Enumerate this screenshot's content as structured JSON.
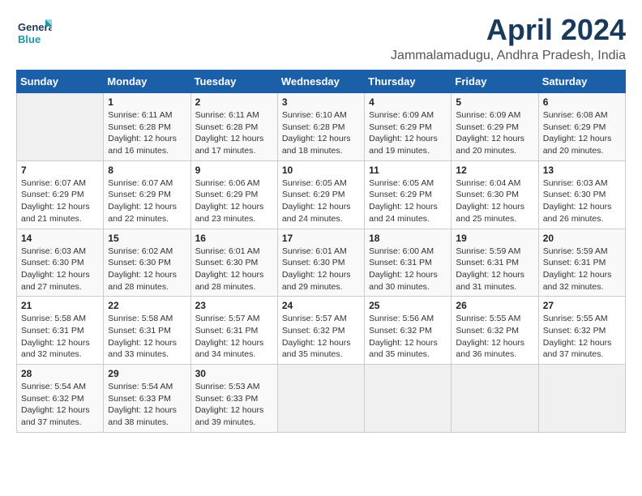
{
  "logo": {
    "line1": "General",
    "line2": "Blue"
  },
  "title": "April 2024",
  "subtitle": "Jammalamadugu, Andhra Pradesh, India",
  "weekdays": [
    "Sunday",
    "Monday",
    "Tuesday",
    "Wednesday",
    "Thursday",
    "Friday",
    "Saturday"
  ],
  "weeks": [
    [
      {
        "day": "",
        "info": ""
      },
      {
        "day": "1",
        "info": "Sunrise: 6:11 AM\nSunset: 6:28 PM\nDaylight: 12 hours\nand 16 minutes."
      },
      {
        "day": "2",
        "info": "Sunrise: 6:11 AM\nSunset: 6:28 PM\nDaylight: 12 hours\nand 17 minutes."
      },
      {
        "day": "3",
        "info": "Sunrise: 6:10 AM\nSunset: 6:28 PM\nDaylight: 12 hours\nand 18 minutes."
      },
      {
        "day": "4",
        "info": "Sunrise: 6:09 AM\nSunset: 6:29 PM\nDaylight: 12 hours\nand 19 minutes."
      },
      {
        "day": "5",
        "info": "Sunrise: 6:09 AM\nSunset: 6:29 PM\nDaylight: 12 hours\nand 20 minutes."
      },
      {
        "day": "6",
        "info": "Sunrise: 6:08 AM\nSunset: 6:29 PM\nDaylight: 12 hours\nand 20 minutes."
      }
    ],
    [
      {
        "day": "7",
        "info": "Sunrise: 6:07 AM\nSunset: 6:29 PM\nDaylight: 12 hours\nand 21 minutes."
      },
      {
        "day": "8",
        "info": "Sunrise: 6:07 AM\nSunset: 6:29 PM\nDaylight: 12 hours\nand 22 minutes."
      },
      {
        "day": "9",
        "info": "Sunrise: 6:06 AM\nSunset: 6:29 PM\nDaylight: 12 hours\nand 23 minutes."
      },
      {
        "day": "10",
        "info": "Sunrise: 6:05 AM\nSunset: 6:29 PM\nDaylight: 12 hours\nand 24 minutes."
      },
      {
        "day": "11",
        "info": "Sunrise: 6:05 AM\nSunset: 6:29 PM\nDaylight: 12 hours\nand 24 minutes."
      },
      {
        "day": "12",
        "info": "Sunrise: 6:04 AM\nSunset: 6:30 PM\nDaylight: 12 hours\nand 25 minutes."
      },
      {
        "day": "13",
        "info": "Sunrise: 6:03 AM\nSunset: 6:30 PM\nDaylight: 12 hours\nand 26 minutes."
      }
    ],
    [
      {
        "day": "14",
        "info": "Sunrise: 6:03 AM\nSunset: 6:30 PM\nDaylight: 12 hours\nand 27 minutes."
      },
      {
        "day": "15",
        "info": "Sunrise: 6:02 AM\nSunset: 6:30 PM\nDaylight: 12 hours\nand 28 minutes."
      },
      {
        "day": "16",
        "info": "Sunrise: 6:01 AM\nSunset: 6:30 PM\nDaylight: 12 hours\nand 28 minutes."
      },
      {
        "day": "17",
        "info": "Sunrise: 6:01 AM\nSunset: 6:30 PM\nDaylight: 12 hours\nand 29 minutes."
      },
      {
        "day": "18",
        "info": "Sunrise: 6:00 AM\nSunset: 6:31 PM\nDaylight: 12 hours\nand 30 minutes."
      },
      {
        "day": "19",
        "info": "Sunrise: 5:59 AM\nSunset: 6:31 PM\nDaylight: 12 hours\nand 31 minutes."
      },
      {
        "day": "20",
        "info": "Sunrise: 5:59 AM\nSunset: 6:31 PM\nDaylight: 12 hours\nand 32 minutes."
      }
    ],
    [
      {
        "day": "21",
        "info": "Sunrise: 5:58 AM\nSunset: 6:31 PM\nDaylight: 12 hours\nand 32 minutes."
      },
      {
        "day": "22",
        "info": "Sunrise: 5:58 AM\nSunset: 6:31 PM\nDaylight: 12 hours\nand 33 minutes."
      },
      {
        "day": "23",
        "info": "Sunrise: 5:57 AM\nSunset: 6:31 PM\nDaylight: 12 hours\nand 34 minutes."
      },
      {
        "day": "24",
        "info": "Sunrise: 5:57 AM\nSunset: 6:32 PM\nDaylight: 12 hours\nand 35 minutes."
      },
      {
        "day": "25",
        "info": "Sunrise: 5:56 AM\nSunset: 6:32 PM\nDaylight: 12 hours\nand 35 minutes."
      },
      {
        "day": "26",
        "info": "Sunrise: 5:55 AM\nSunset: 6:32 PM\nDaylight: 12 hours\nand 36 minutes."
      },
      {
        "day": "27",
        "info": "Sunrise: 5:55 AM\nSunset: 6:32 PM\nDaylight: 12 hours\nand 37 minutes."
      }
    ],
    [
      {
        "day": "28",
        "info": "Sunrise: 5:54 AM\nSunset: 6:32 PM\nDaylight: 12 hours\nand 37 minutes."
      },
      {
        "day": "29",
        "info": "Sunrise: 5:54 AM\nSunset: 6:33 PM\nDaylight: 12 hours\nand 38 minutes."
      },
      {
        "day": "30",
        "info": "Sunrise: 5:53 AM\nSunset: 6:33 PM\nDaylight: 12 hours\nand 39 minutes."
      },
      {
        "day": "",
        "info": ""
      },
      {
        "day": "",
        "info": ""
      },
      {
        "day": "",
        "info": ""
      },
      {
        "day": "",
        "info": ""
      }
    ]
  ]
}
